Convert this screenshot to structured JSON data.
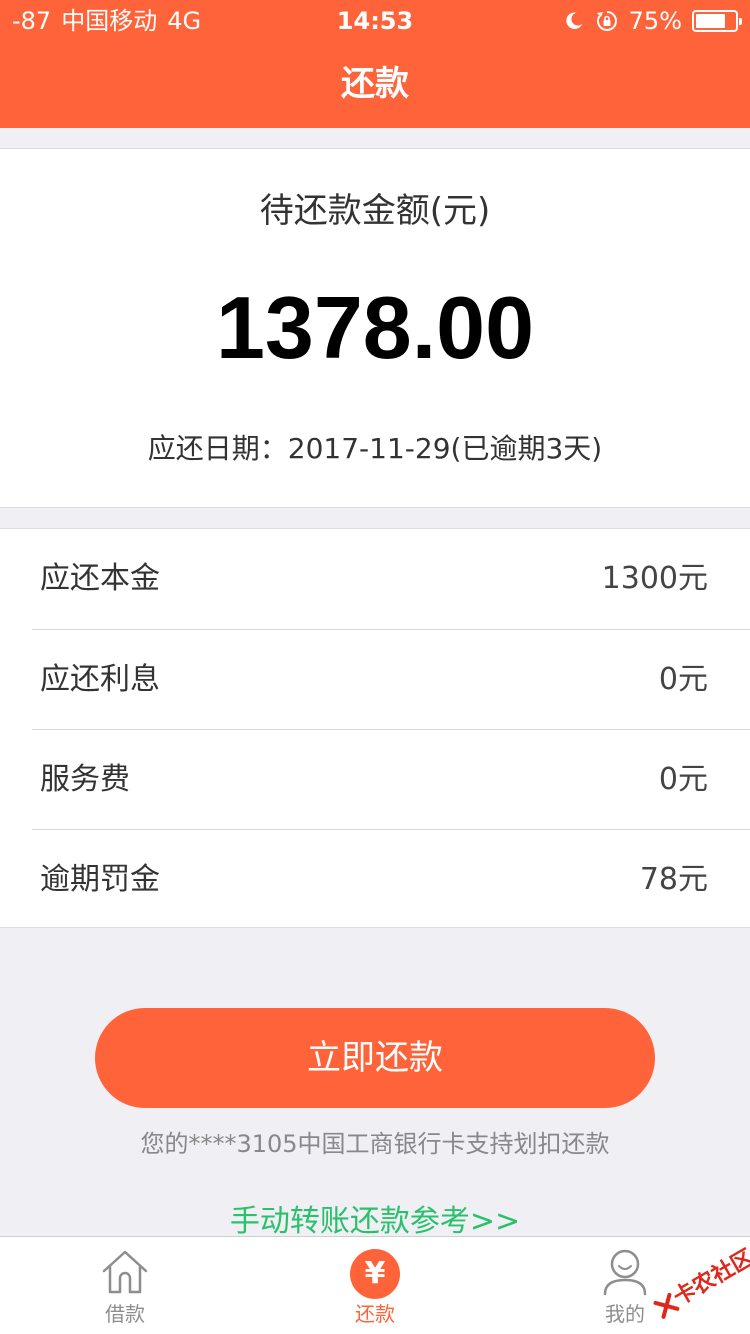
{
  "status_bar": {
    "signal": "-87",
    "carrier": "中国移动",
    "network": "4G",
    "time": "14:53",
    "battery_percent": "75%",
    "battery_level": 0.75,
    "icons": [
      "moon-icon",
      "rotation-lock-icon",
      "battery-icon"
    ]
  },
  "header": {
    "title": "还款"
  },
  "summary": {
    "label": "待还款金额(元)",
    "amount": "1378.00",
    "due_date": "应还日期：2017-11-29(已逾期3天)"
  },
  "details": [
    {
      "label": "应还本金",
      "value": "1300元"
    },
    {
      "label": "应还利息",
      "value": "0元"
    },
    {
      "label": "服务费",
      "value": "0元"
    },
    {
      "label": "逾期罚金",
      "value": "78元"
    }
  ],
  "actions": {
    "repay_button": "立即还款",
    "card_note": "您的****3105中国工商银行卡支持划扣还款",
    "manual_link": "手动转账还款参考>>"
  },
  "tab_bar": {
    "items": [
      {
        "label": "借款",
        "icon": "house-icon",
        "active": false
      },
      {
        "label": "还款",
        "icon": "yen-icon",
        "active": true
      },
      {
        "label": "我的",
        "icon": "user-icon",
        "active": false
      }
    ]
  },
  "watermark": {
    "text": "卡农社区"
  },
  "colors": {
    "accent": "#ff6339",
    "link_green": "#2bc06b",
    "background": "#efeff4",
    "tab_inactive": "#8e8e8e"
  }
}
